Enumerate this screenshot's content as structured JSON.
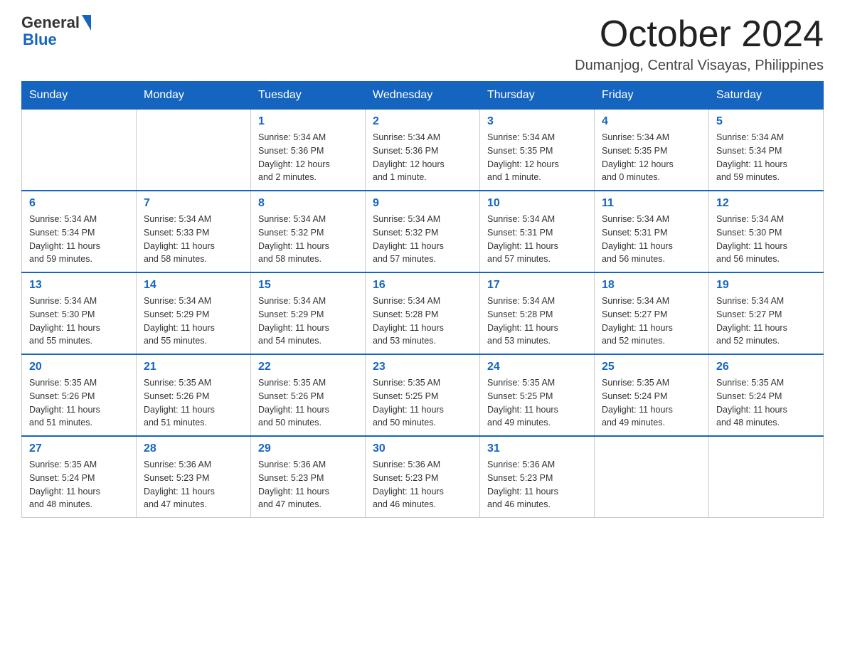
{
  "header": {
    "logo_general": "General",
    "logo_blue": "Blue",
    "month_title": "October 2024",
    "location": "Dumanjog, Central Visayas, Philippines"
  },
  "weekdays": [
    "Sunday",
    "Monday",
    "Tuesday",
    "Wednesday",
    "Thursday",
    "Friday",
    "Saturday"
  ],
  "weeks": [
    [
      {
        "day": "",
        "info": ""
      },
      {
        "day": "",
        "info": ""
      },
      {
        "day": "1",
        "info": "Sunrise: 5:34 AM\nSunset: 5:36 PM\nDaylight: 12 hours\nand 2 minutes."
      },
      {
        "day": "2",
        "info": "Sunrise: 5:34 AM\nSunset: 5:36 PM\nDaylight: 12 hours\nand 1 minute."
      },
      {
        "day": "3",
        "info": "Sunrise: 5:34 AM\nSunset: 5:35 PM\nDaylight: 12 hours\nand 1 minute."
      },
      {
        "day": "4",
        "info": "Sunrise: 5:34 AM\nSunset: 5:35 PM\nDaylight: 12 hours\nand 0 minutes."
      },
      {
        "day": "5",
        "info": "Sunrise: 5:34 AM\nSunset: 5:34 PM\nDaylight: 11 hours\nand 59 minutes."
      }
    ],
    [
      {
        "day": "6",
        "info": "Sunrise: 5:34 AM\nSunset: 5:34 PM\nDaylight: 11 hours\nand 59 minutes."
      },
      {
        "day": "7",
        "info": "Sunrise: 5:34 AM\nSunset: 5:33 PM\nDaylight: 11 hours\nand 58 minutes."
      },
      {
        "day": "8",
        "info": "Sunrise: 5:34 AM\nSunset: 5:32 PM\nDaylight: 11 hours\nand 58 minutes."
      },
      {
        "day": "9",
        "info": "Sunrise: 5:34 AM\nSunset: 5:32 PM\nDaylight: 11 hours\nand 57 minutes."
      },
      {
        "day": "10",
        "info": "Sunrise: 5:34 AM\nSunset: 5:31 PM\nDaylight: 11 hours\nand 57 minutes."
      },
      {
        "day": "11",
        "info": "Sunrise: 5:34 AM\nSunset: 5:31 PM\nDaylight: 11 hours\nand 56 minutes."
      },
      {
        "day": "12",
        "info": "Sunrise: 5:34 AM\nSunset: 5:30 PM\nDaylight: 11 hours\nand 56 minutes."
      }
    ],
    [
      {
        "day": "13",
        "info": "Sunrise: 5:34 AM\nSunset: 5:30 PM\nDaylight: 11 hours\nand 55 minutes."
      },
      {
        "day": "14",
        "info": "Sunrise: 5:34 AM\nSunset: 5:29 PM\nDaylight: 11 hours\nand 55 minutes."
      },
      {
        "day": "15",
        "info": "Sunrise: 5:34 AM\nSunset: 5:29 PM\nDaylight: 11 hours\nand 54 minutes."
      },
      {
        "day": "16",
        "info": "Sunrise: 5:34 AM\nSunset: 5:28 PM\nDaylight: 11 hours\nand 53 minutes."
      },
      {
        "day": "17",
        "info": "Sunrise: 5:34 AM\nSunset: 5:28 PM\nDaylight: 11 hours\nand 53 minutes."
      },
      {
        "day": "18",
        "info": "Sunrise: 5:34 AM\nSunset: 5:27 PM\nDaylight: 11 hours\nand 52 minutes."
      },
      {
        "day": "19",
        "info": "Sunrise: 5:34 AM\nSunset: 5:27 PM\nDaylight: 11 hours\nand 52 minutes."
      }
    ],
    [
      {
        "day": "20",
        "info": "Sunrise: 5:35 AM\nSunset: 5:26 PM\nDaylight: 11 hours\nand 51 minutes."
      },
      {
        "day": "21",
        "info": "Sunrise: 5:35 AM\nSunset: 5:26 PM\nDaylight: 11 hours\nand 51 minutes."
      },
      {
        "day": "22",
        "info": "Sunrise: 5:35 AM\nSunset: 5:26 PM\nDaylight: 11 hours\nand 50 minutes."
      },
      {
        "day": "23",
        "info": "Sunrise: 5:35 AM\nSunset: 5:25 PM\nDaylight: 11 hours\nand 50 minutes."
      },
      {
        "day": "24",
        "info": "Sunrise: 5:35 AM\nSunset: 5:25 PM\nDaylight: 11 hours\nand 49 minutes."
      },
      {
        "day": "25",
        "info": "Sunrise: 5:35 AM\nSunset: 5:24 PM\nDaylight: 11 hours\nand 49 minutes."
      },
      {
        "day": "26",
        "info": "Sunrise: 5:35 AM\nSunset: 5:24 PM\nDaylight: 11 hours\nand 48 minutes."
      }
    ],
    [
      {
        "day": "27",
        "info": "Sunrise: 5:35 AM\nSunset: 5:24 PM\nDaylight: 11 hours\nand 48 minutes."
      },
      {
        "day": "28",
        "info": "Sunrise: 5:36 AM\nSunset: 5:23 PM\nDaylight: 11 hours\nand 47 minutes."
      },
      {
        "day": "29",
        "info": "Sunrise: 5:36 AM\nSunset: 5:23 PM\nDaylight: 11 hours\nand 47 minutes."
      },
      {
        "day": "30",
        "info": "Sunrise: 5:36 AM\nSunset: 5:23 PM\nDaylight: 11 hours\nand 46 minutes."
      },
      {
        "day": "31",
        "info": "Sunrise: 5:36 AM\nSunset: 5:23 PM\nDaylight: 11 hours\nand 46 minutes."
      },
      {
        "day": "",
        "info": ""
      },
      {
        "day": "",
        "info": ""
      }
    ]
  ]
}
